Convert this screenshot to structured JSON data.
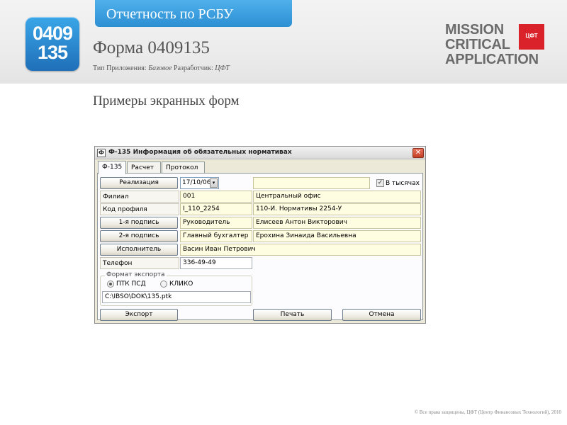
{
  "header": {
    "section_tab": "Отчетность по РСБУ",
    "badge_line1": "0409",
    "badge_line2": "135",
    "title": "Форма 0409135",
    "meta_type_label": "Тип Приложения:",
    "meta_type_value": "Базовое",
    "meta_dev_label": "Разработчик:",
    "meta_dev_value": "ЦФТ",
    "logo_lines": [
      "MISSION",
      "CRITICAL",
      "APPLICATION"
    ],
    "logo_mark": "ЦФТ"
  },
  "subtitle": "Примеры экранных форм",
  "dialog": {
    "app_icon": "Ф",
    "title": "Ф-135 Информация об обязательных нормативах",
    "close_glyph": "✕",
    "tabs": [
      "Ф-135",
      "Расчет",
      "Протокол"
    ],
    "realization_button": "Реализация",
    "date_value": "17/10/06",
    "date_drop_glyph": "▾",
    "thousands_label": "В тысячах",
    "thousands_checked": true,
    "rows": [
      {
        "label": "Филиал",
        "code": "001",
        "value": "Центральный офис"
      },
      {
        "label": "Код профиля",
        "code": "I_110_2254",
        "value": "110-И. Нормативы 2254-У"
      }
    ],
    "signers": [
      {
        "button": "1-я подпись",
        "role": "Руководитель",
        "name": "Елисеев Антон Викторович"
      },
      {
        "button": "2-я подпись",
        "role": "Главный бухгалтер",
        "name": "Ерохина Зинаида Васильевна"
      }
    ],
    "executor_button": "Исполнитель",
    "executor_value": "Васин Иван Петрович",
    "phone_label": "Телефон",
    "phone_value": "336-49-49",
    "export_group_label": "Формат экспорта",
    "export_options": [
      "ПТК ПСД",
      "КЛИКО"
    ],
    "export_selected": "ПТК ПСД",
    "export_path": "C:\\IBSO\\DOK\\135.ptk",
    "buttons": {
      "export": "Экспорт",
      "print": "Печать",
      "cancel": "Отмена"
    }
  },
  "footer": {
    "copyright": "© Все права защищены, ЦФТ (Центр Финансовых Технологий), 2010"
  },
  "colors": {
    "accent_blue": "#2c8fd3",
    "field_yellow": "#fffde1",
    "dialog_bg": "#ece9d8",
    "logo_red": "#d9222a"
  }
}
